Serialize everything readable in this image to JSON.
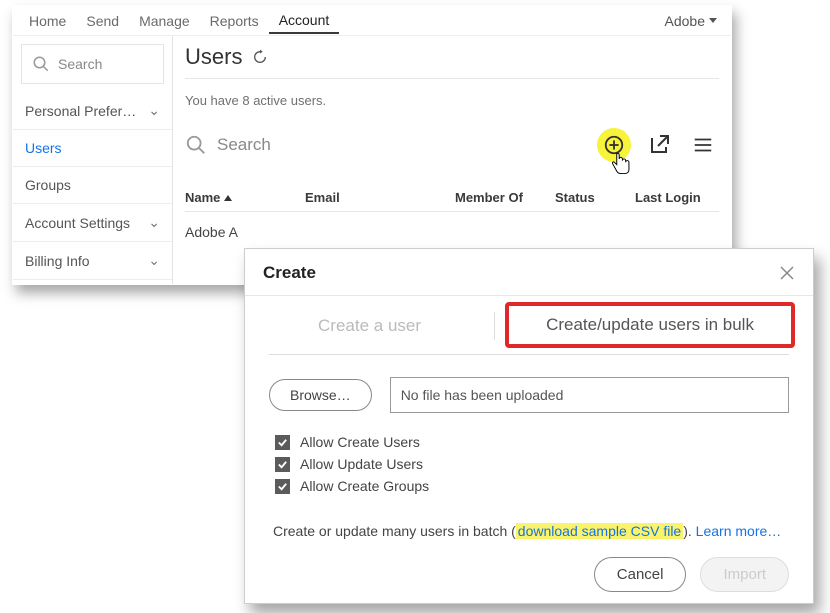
{
  "topnav": {
    "items": [
      "Home",
      "Send",
      "Manage",
      "Reports",
      "Account"
    ],
    "active_index": 4,
    "brand": "Adobe"
  },
  "sidebar": {
    "search_placeholder": "Search",
    "items": [
      {
        "label": "Personal Prefer…",
        "chevron": true
      },
      {
        "label": "Users",
        "chevron": false,
        "active": true
      },
      {
        "label": "Groups",
        "chevron": false
      },
      {
        "label": "Account Settings",
        "chevron": true
      },
      {
        "label": "Billing Info",
        "chevron": true
      }
    ]
  },
  "content": {
    "title": "Users",
    "hint": "You have 8 active users.",
    "search_placeholder": "Search",
    "columns": {
      "name": "Name",
      "email": "Email",
      "member": "Member Of",
      "status": "Status",
      "login": "Last Login"
    },
    "row1_name": "Adobe A"
  },
  "modal": {
    "title": "Create",
    "tab_create": "Create a user",
    "tab_bulk": "Create/update users in bulk",
    "browse_label": "Browse…",
    "file_status": "No file has been uploaded",
    "checks": {
      "create_users": "Allow Create Users",
      "update_users": "Allow Update Users",
      "create_groups": "Allow Create Groups"
    },
    "info_prefix": "Create or update many users in batch (",
    "info_link1": "download sample CSV file",
    "info_mid": "). ",
    "info_link2": "Learn more…",
    "cancel": "Cancel",
    "import": "Import"
  }
}
